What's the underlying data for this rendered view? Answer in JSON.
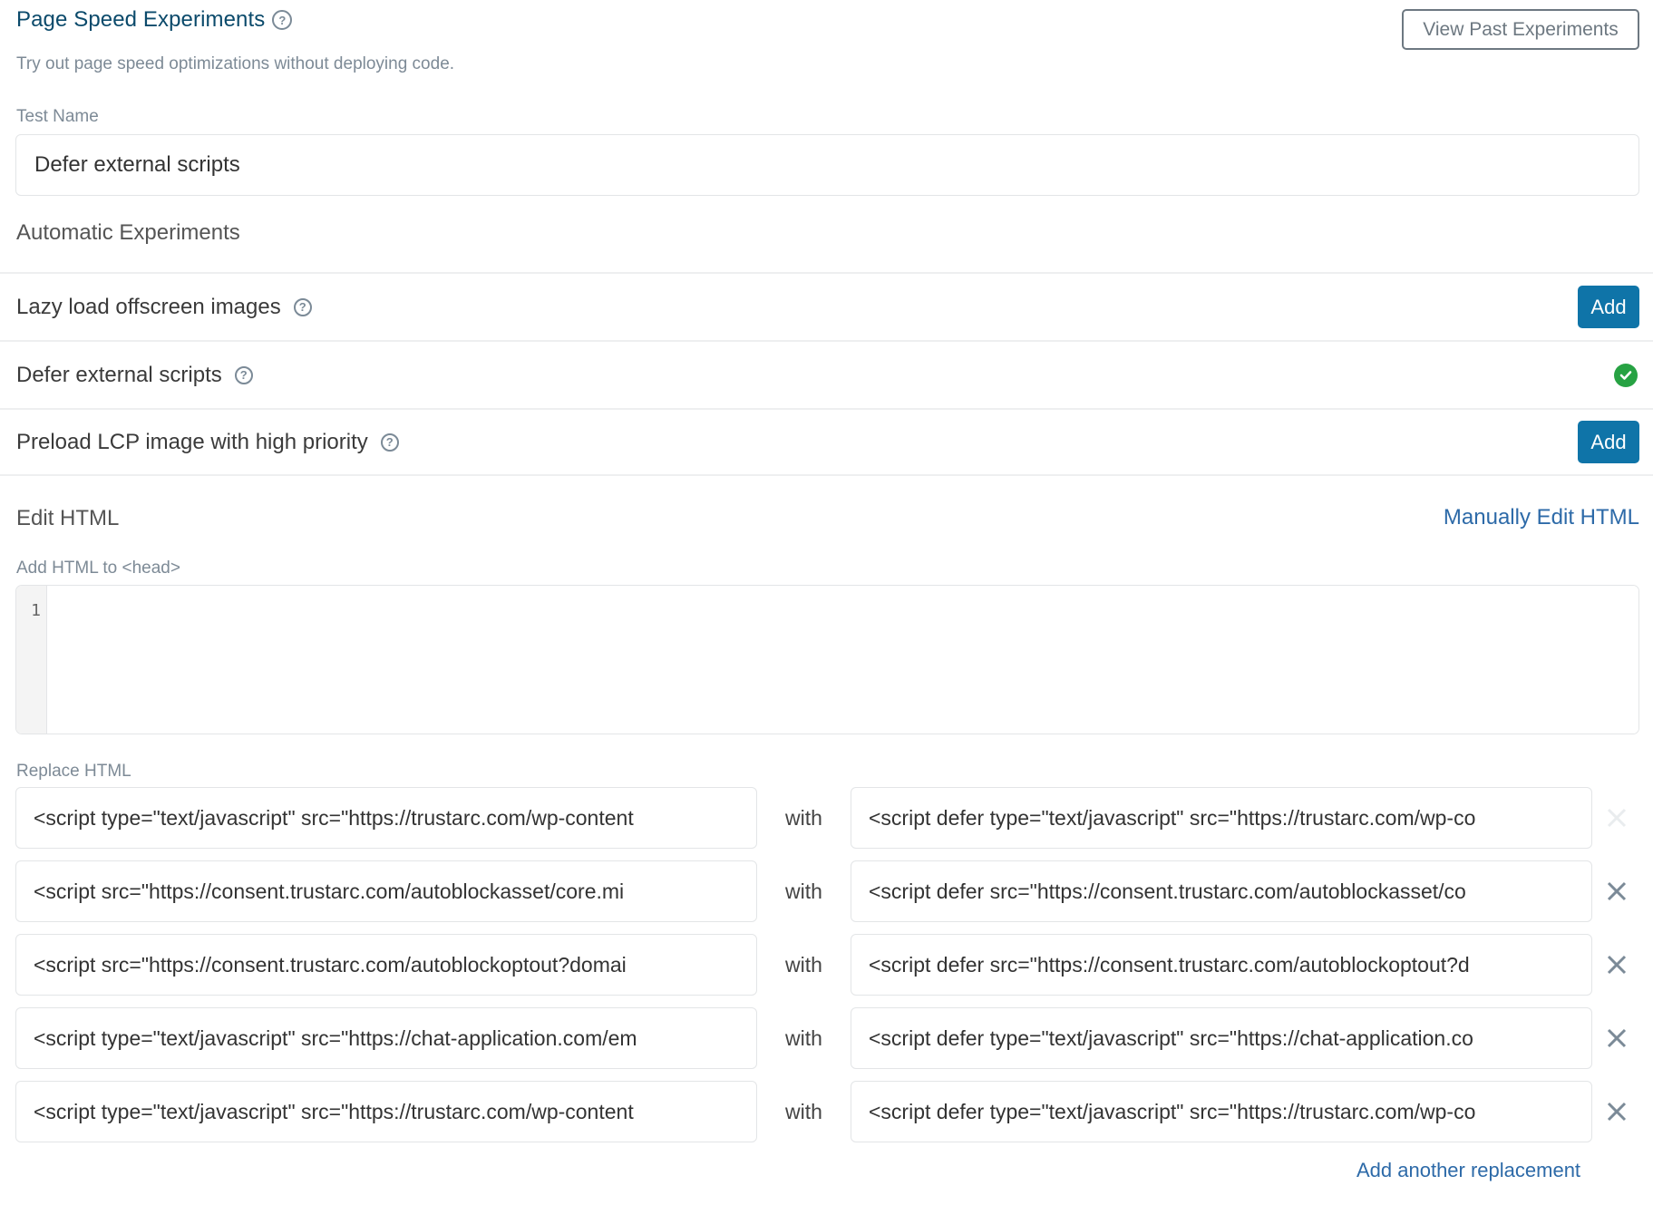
{
  "header": {
    "title": "Page Speed Experiments",
    "subtitle": "Try out page speed optimizations without deploying code.",
    "view_past_label": "View Past Experiments"
  },
  "test_name": {
    "label": "Test Name",
    "value": "Defer external scripts"
  },
  "automatic": {
    "heading": "Automatic Experiments",
    "items": [
      {
        "label": "Lazy load offscreen images",
        "state": "add",
        "action_label": "Add"
      },
      {
        "label": "Defer external scripts",
        "state": "added",
        "action_label": ""
      },
      {
        "label": "Preload LCP image with high priority",
        "state": "add",
        "action_label": "Add"
      }
    ]
  },
  "edit_html": {
    "heading": "Edit HTML",
    "manual_link": "Manually Edit HTML",
    "head_label": "Add HTML to <head>",
    "editor_line_number": "1",
    "editor_content": ""
  },
  "replace": {
    "label": "Replace HTML",
    "with_label": "with",
    "rows": [
      {
        "find": "<script type=\"text/javascript\" src=\"https://trustarc.com/wp-content",
        "replace": "<script defer type=\"text/javascript\" src=\"https://trustarc.com/wp-co",
        "removable": false
      },
      {
        "find": "<script src=\"https://consent.trustarc.com/autoblockasset/core.mi",
        "replace": "<script defer src=\"https://consent.trustarc.com/autoblockasset/co",
        "removable": true
      },
      {
        "find": "<script src=\"https://consent.trustarc.com/autoblockoptout?domai",
        "replace": "<script defer src=\"https://consent.trustarc.com/autoblockoptout?d",
        "removable": true
      },
      {
        "find": "<script type=\"text/javascript\" src=\"https://chat-application.com/em",
        "replace": "<script defer type=\"text/javascript\" src=\"https://chat-application.co",
        "removable": true
      },
      {
        "find": "<script type=\"text/javascript\" src=\"https://trustarc.com/wp-content",
        "replace": "<script defer type=\"text/javascript\" src=\"https://trustarc.com/wp-co",
        "removable": true
      }
    ],
    "add_another_label": "Add another replacement"
  },
  "colors": {
    "title": "#0b4a6b",
    "primary_button": "#0f74a8",
    "link": "#2d6aa8",
    "success": "#27a243"
  }
}
